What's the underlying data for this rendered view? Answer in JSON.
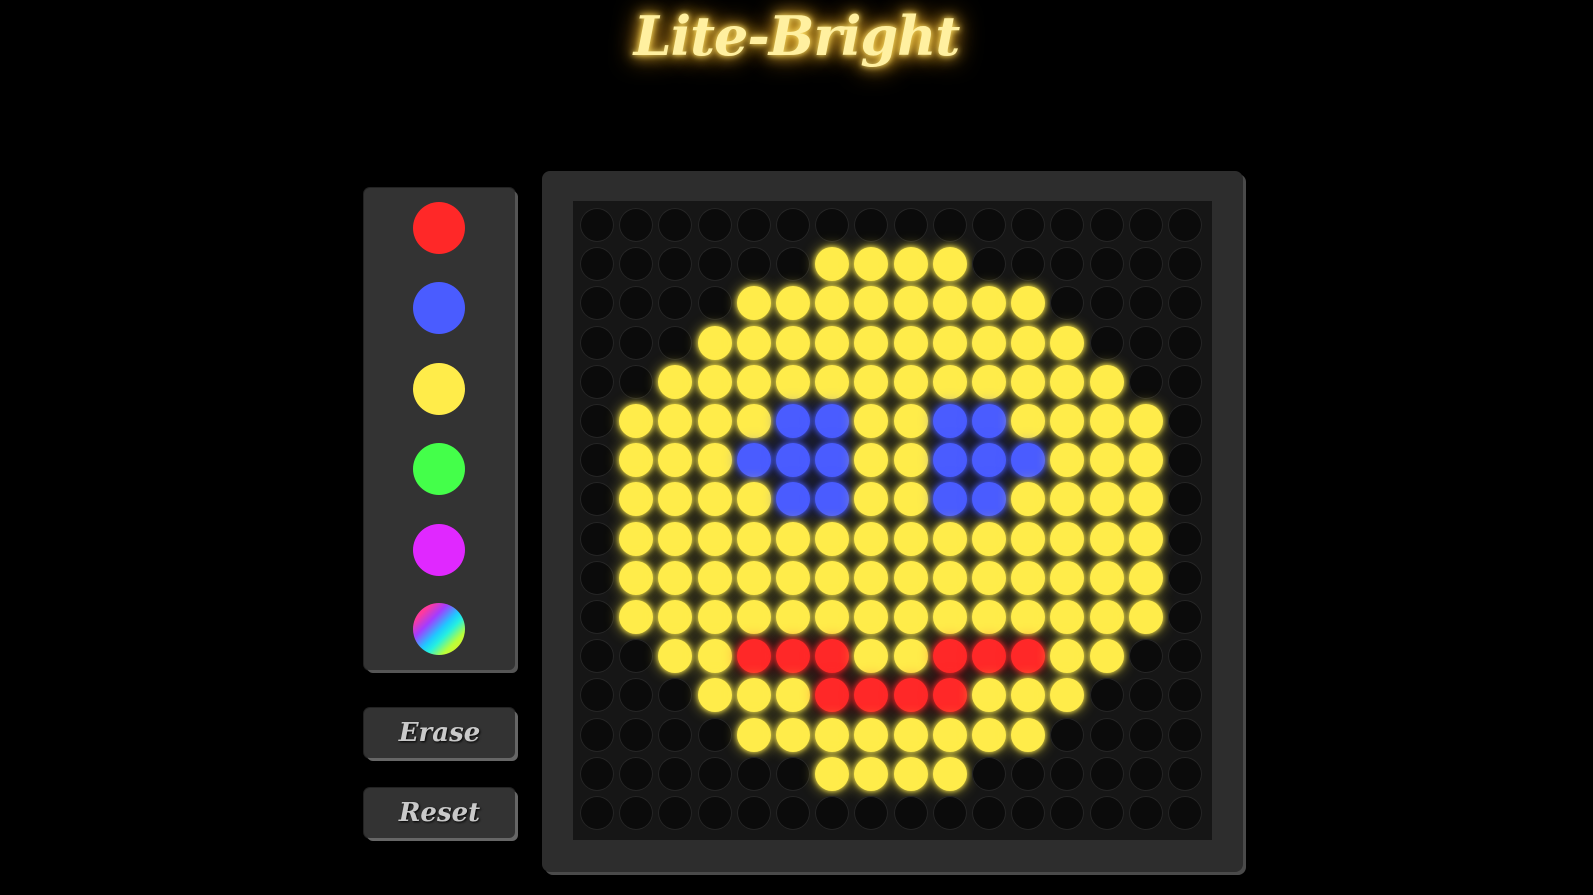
{
  "app": {
    "title": "Lite-Bright"
  },
  "palette": {
    "colors": [
      {
        "name": "red",
        "hex": "#ff2828"
      },
      {
        "name": "blue",
        "hex": "#4a5cff"
      },
      {
        "name": "yellow",
        "hex": "#ffec4a"
      },
      {
        "name": "green",
        "hex": "#44ff4a"
      },
      {
        "name": "purple",
        "hex": "#e028ff"
      },
      {
        "name": "rainbow",
        "hex": "gradient"
      }
    ]
  },
  "controls": {
    "erase_label": "Erase",
    "reset_label": "Reset"
  },
  "board": {
    "rows": 16,
    "cols": 16,
    "legend": {
      ".": "off",
      "Y": "#ffec4a",
      "B": "#4a5cff",
      "R": "#ff2828"
    },
    "grid": [
      "................",
      "......YYYY......",
      "....YYYYYYYY....",
      "...YYYYYYYYYY...",
      "..YYYYYYYYYYYY..",
      ".YYYYBBYYBBYYYY.",
      ".YYYBBBYYBBBYYY.",
      ".YYYYBBYYBBYYYY.",
      ".YYYYYYYYYYYYYY.",
      ".YYYYYYYYYYYYYY.",
      ".YYYYYYYYYYYYYY.",
      "..YYRRRYYRRRYY..",
      "...YYYRRRRYYY...",
      "....YYYYYYYY....",
      "......YYYY......",
      "................"
    ]
  }
}
